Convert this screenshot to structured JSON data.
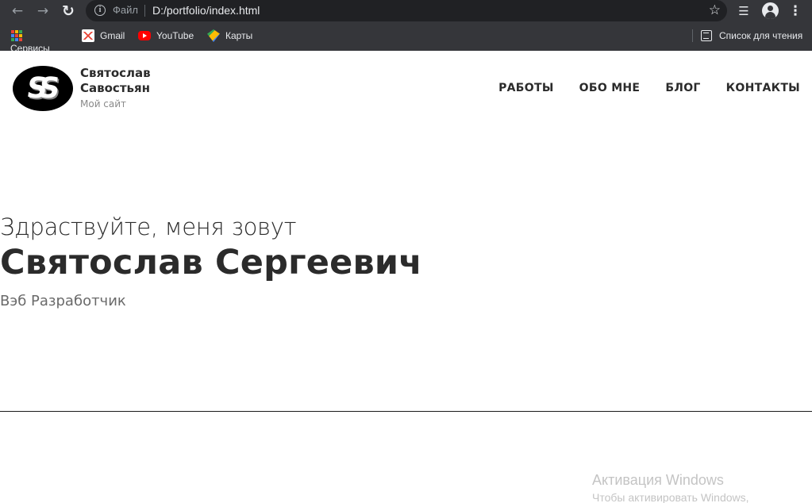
{
  "browser": {
    "scheme_label": "Файл",
    "url": "D:/portfolio/index.html",
    "icons": {
      "back": "arrow-left-icon",
      "forward": "arrow-right-icon",
      "reload": "reload-icon",
      "info": "info-icon",
      "bookmark": "star-icon",
      "media": "media-queue-icon",
      "profile": "profile-icon",
      "menu": "kebab-menu-icon"
    },
    "bookmarks": [
      {
        "label": "Сервисы",
        "icon": "apps-grid-icon"
      },
      {
        "label": "Gmail",
        "icon": "gmail-icon"
      },
      {
        "label": "YouTube",
        "icon": "youtube-icon"
      },
      {
        "label": "Карты",
        "icon": "maps-icon"
      }
    ],
    "reading_list_label": "Список для чтения",
    "colors": {
      "frame": "#35363a",
      "omnibox": "#202124",
      "text": "#e8eaed"
    }
  },
  "site": {
    "logo_text": "SS",
    "brand_line1": "Святослав",
    "brand_line2": "Савостьян",
    "brand_subtitle": "Мой сайт",
    "nav": [
      {
        "label": "РАБОТЫ"
      },
      {
        "label": "ОБО МНЕ"
      },
      {
        "label": "БЛОГ"
      },
      {
        "label": "КОНТАКТЫ"
      }
    ],
    "hero": {
      "greeting": "Здраствуйте, меня зовут",
      "name": "Святослав Сергеевич",
      "role": "Вэб Разработчик"
    },
    "colors": {
      "text": "#2b2b2b",
      "muted": "#6a6a6a"
    }
  },
  "os_overlay": {
    "title": "Активация Windows",
    "subtitle": "Чтобы активировать Windows,"
  }
}
